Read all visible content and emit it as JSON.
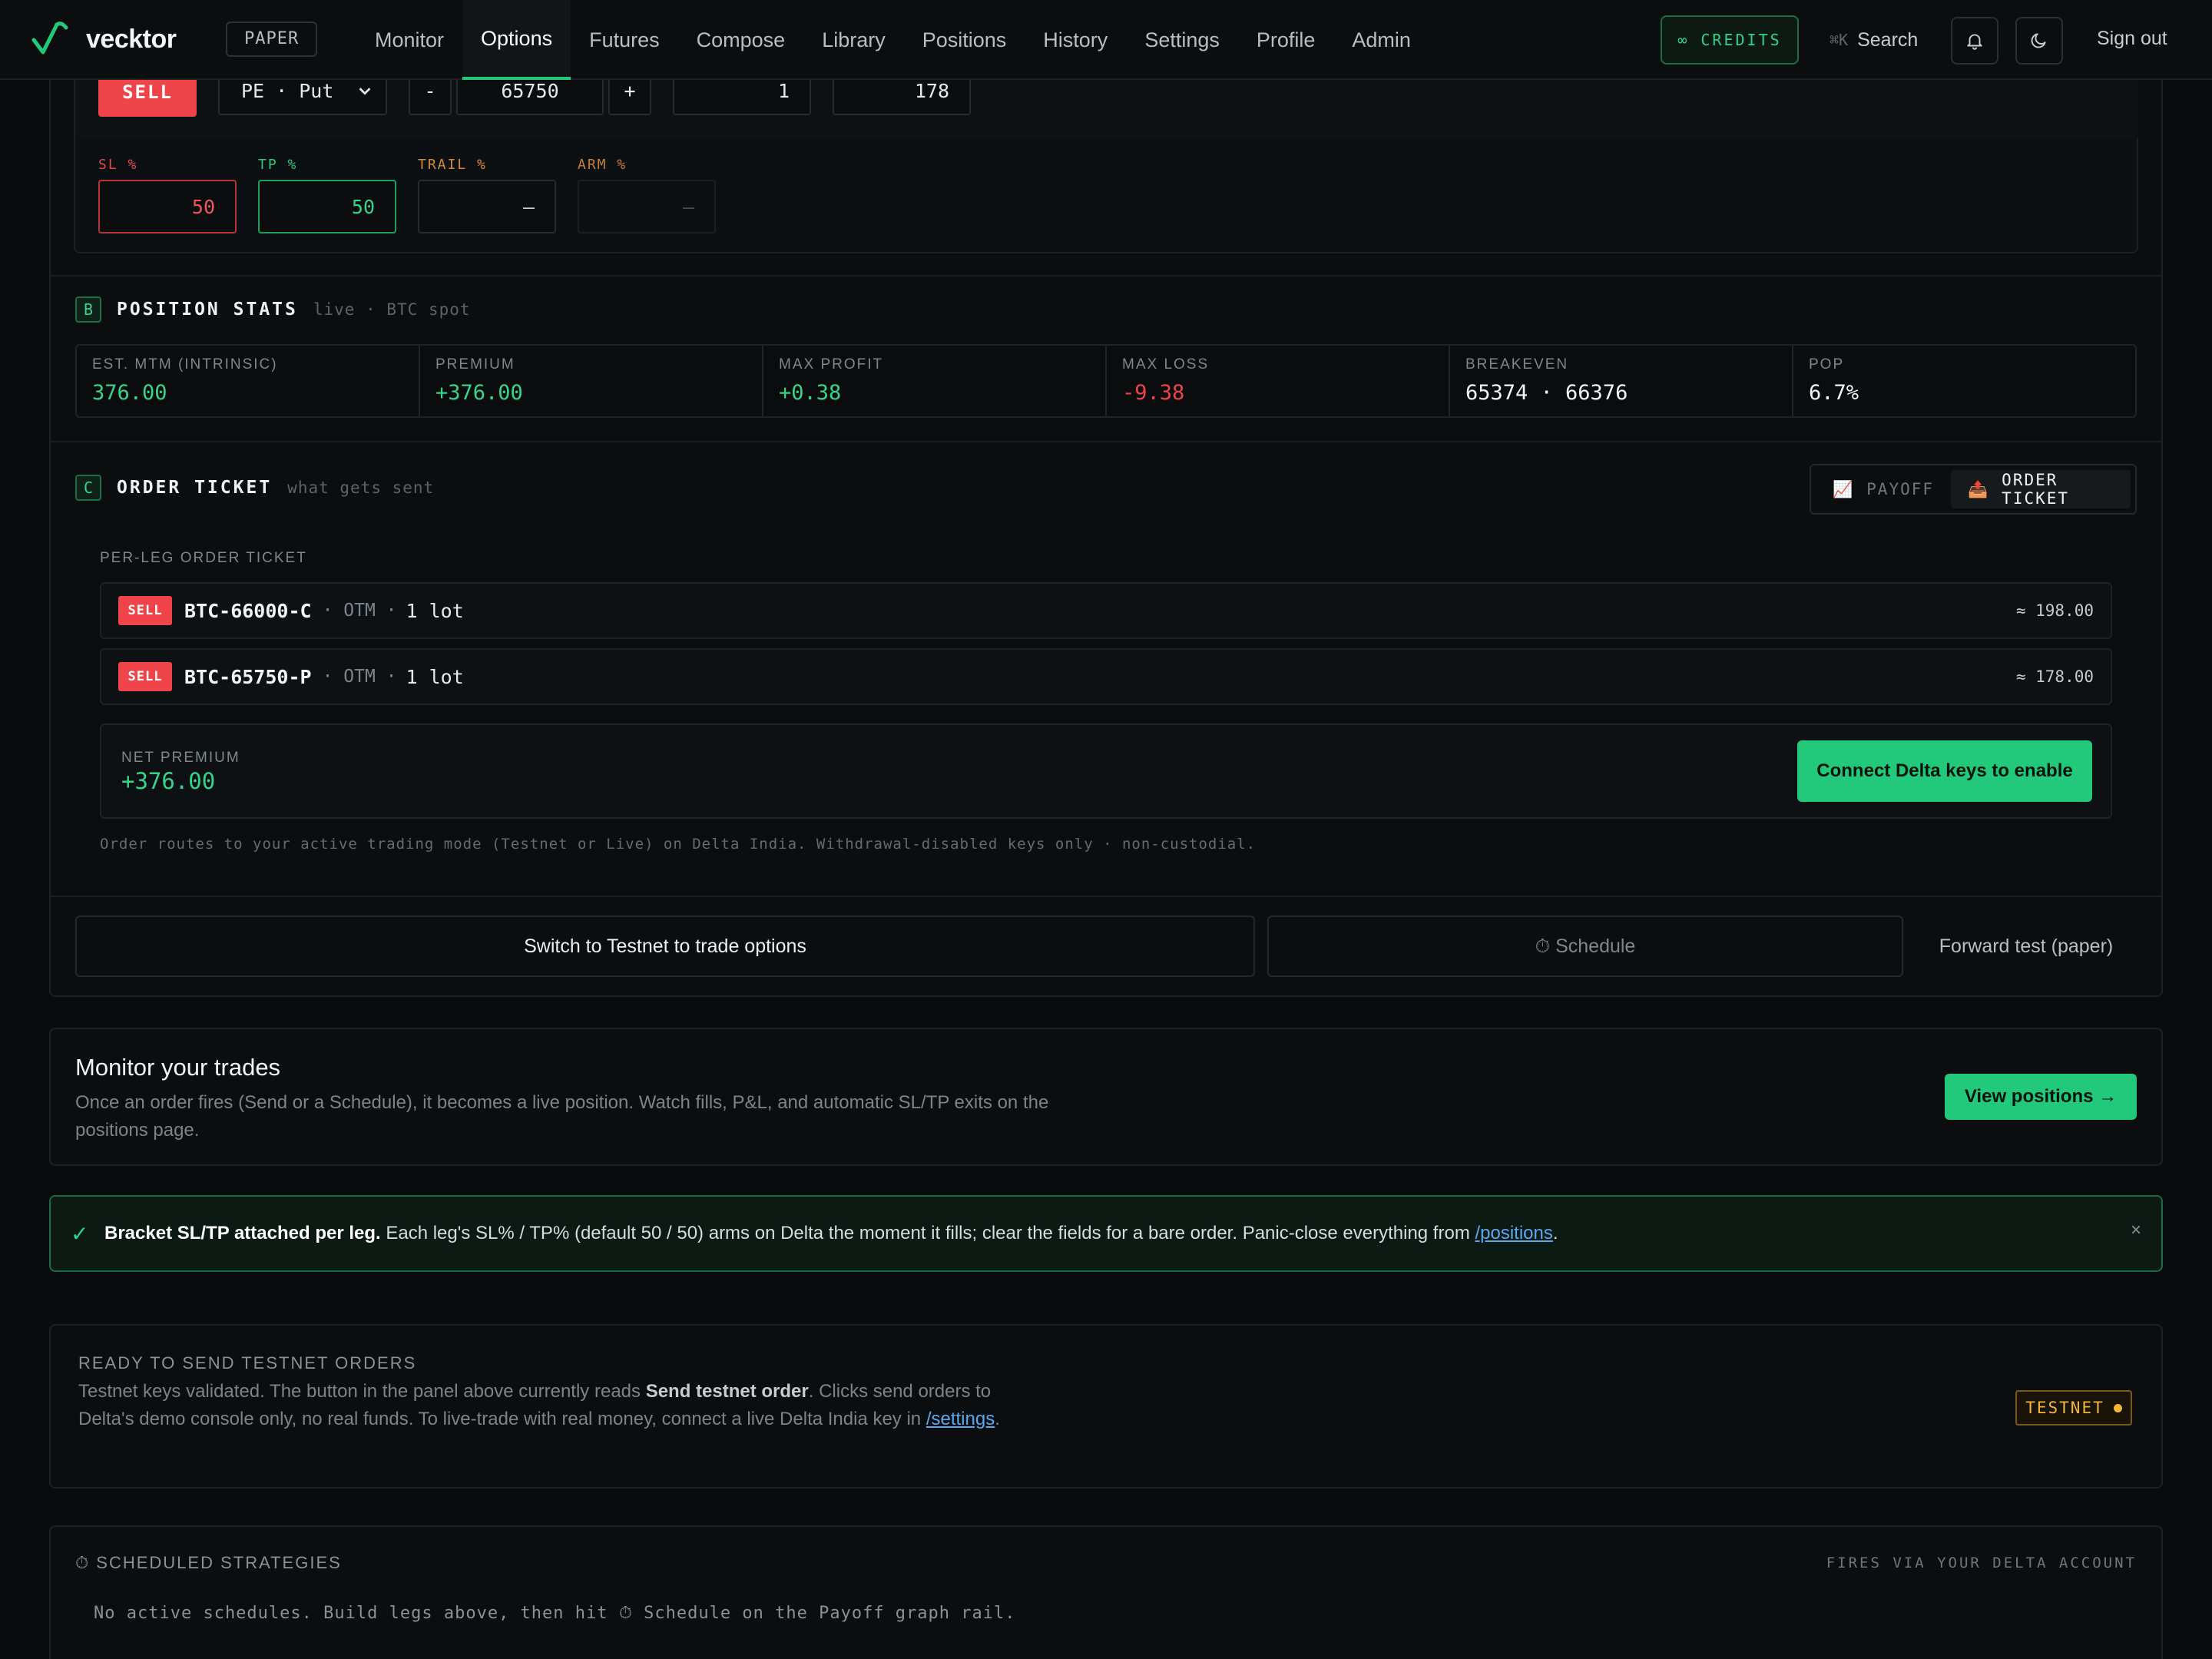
{
  "app": {
    "name": "vecktor",
    "mode_badge": "PAPER",
    "nav": [
      "Monitor",
      "Options",
      "Futures",
      "Compose",
      "Library",
      "Positions",
      "History",
      "Settings",
      "Profile",
      "Admin"
    ],
    "active_nav": "Options",
    "credits_label": "∞  CREDITS",
    "search_label": "Search",
    "search_kbd": "⌘K",
    "signout_label": "Sign out",
    "accent": "#22c97a"
  },
  "leg_editor": {
    "side": "SELL",
    "option_type": "PE · Put",
    "decrement": "-",
    "strike": "65750",
    "increment": "+",
    "lots": "1",
    "premium": "178",
    "sl_label": "SL %",
    "sl_value": "50",
    "tp_label": "TP %",
    "tp_value": "50",
    "trail_label": "TRAIL %",
    "trail_value": "—",
    "arm_label": "ARM %",
    "arm_value": "—"
  },
  "position_stats": {
    "chip": "B",
    "title": "POSITION STATS",
    "subtitle": "live · BTC spot",
    "stats": [
      {
        "label": "EST. MTM (INTRINSIC)",
        "value": "376.00",
        "tone": "green"
      },
      {
        "label": "PREMIUM",
        "value": "+376.00",
        "tone": "green"
      },
      {
        "label": "MAX PROFIT",
        "value": "+0.38",
        "tone": "green"
      },
      {
        "label": "MAX LOSS",
        "value": "-9.38",
        "tone": "red"
      },
      {
        "label": "BREAKEVEN",
        "value": "65374 · 66376",
        "tone": "white"
      },
      {
        "label": "POP",
        "value": "6.7%",
        "tone": "white"
      }
    ]
  },
  "order_ticket": {
    "chip": "C",
    "title": "ORDER TICKET",
    "subtitle": "what gets sent",
    "toggle_payoff": "PAYOFF",
    "toggle_ticket": "ORDER TICKET",
    "per_leg_label": "PER-LEG ORDER TICKET",
    "legs": [
      {
        "side": "SELL",
        "symbol": "BTC-66000-C",
        "moneyness": "· OTM ·",
        "lots": "1 lot",
        "approx": "≈ 198.00"
      },
      {
        "side": "SELL",
        "symbol": "BTC-65750-P",
        "moneyness": "· OTM ·",
        "lots": "1 lot",
        "approx": "≈ 178.00"
      }
    ],
    "net_label": "NET PREMIUM",
    "net_value": "+376.00",
    "connect_label": "Connect Delta keys to enable",
    "route_note": "Order routes to your active trading mode (Testnet or Live) on Delta India. Withdrawal-disabled keys only · non-custodial."
  },
  "actions": {
    "switch_label": "Switch to Testnet to trade options",
    "schedule_label": "⏱ Schedule",
    "forward_label": "Forward test (paper)"
  },
  "monitor": {
    "title": "Monitor your trades",
    "description": "Once an order fires (Send or a Schedule), it becomes a live position. Watch fills, P&L, and automatic SL/TP exits on the positions page.",
    "button": "View positions →"
  },
  "bracket_banner": {
    "check": "✓",
    "bold": "Bracket SL/TP attached per leg.",
    "text": " Each leg's SL% / TP% (default 50 / 50) arms on Delta the moment it fills; clear the fields for a bare order. Panic-close everything from ",
    "link": "/positions",
    "end": ".",
    "close": "×"
  },
  "testnet": {
    "title": "READY TO SEND TESTNET ORDERS",
    "desc_1": "Testnet keys validated. The button in the panel above currently reads ",
    "desc_bold": "Send testnet order",
    "desc_2": ". Clicks send orders to Delta's demo console only, no real funds. To live-trade with real money, connect a live Delta India key in ",
    "desc_link": "/settings",
    "desc_end": ".",
    "badge": "TESTNET"
  },
  "scheduled": {
    "title": "⏱ SCHEDULED STRATEGIES",
    "right": "FIRES VIA YOUR DELTA ACCOUNT",
    "empty": "No active schedules. Build legs above, then hit ⏱ Schedule on the Payoff graph rail."
  }
}
